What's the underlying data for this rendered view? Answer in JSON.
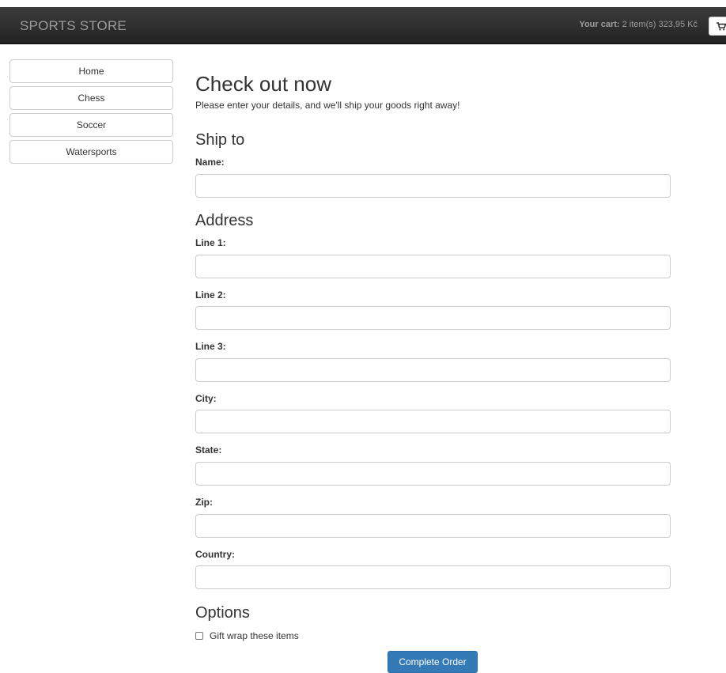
{
  "navbar": {
    "brand": "SPORTS STORE",
    "cart_label": "Your cart:",
    "cart_value": "2 item(s) 323,95 Kč"
  },
  "sidebar": {
    "items": [
      {
        "label": "Home"
      },
      {
        "label": "Chess"
      },
      {
        "label": "Soccer"
      },
      {
        "label": "Watersports"
      }
    ]
  },
  "checkout": {
    "title": "Check out now",
    "intro": "Please enter your details, and we'll ship your goods right away!",
    "ship_to_heading": "Ship to",
    "name_label": "Name:",
    "address_heading": "Address",
    "fields": [
      {
        "label": "Line 1:",
        "value": ""
      },
      {
        "label": "Line 2:",
        "value": ""
      },
      {
        "label": "Line 3:",
        "value": ""
      },
      {
        "label": "City:",
        "value": ""
      },
      {
        "label": "State:",
        "value": ""
      },
      {
        "label": "Zip:",
        "value": ""
      },
      {
        "label": "Country:",
        "value": ""
      }
    ],
    "options_heading": "Options",
    "gift_wrap_label": "Gift wrap these items",
    "gift_wrap_checked": false,
    "submit_label": "Complete Order"
  }
}
